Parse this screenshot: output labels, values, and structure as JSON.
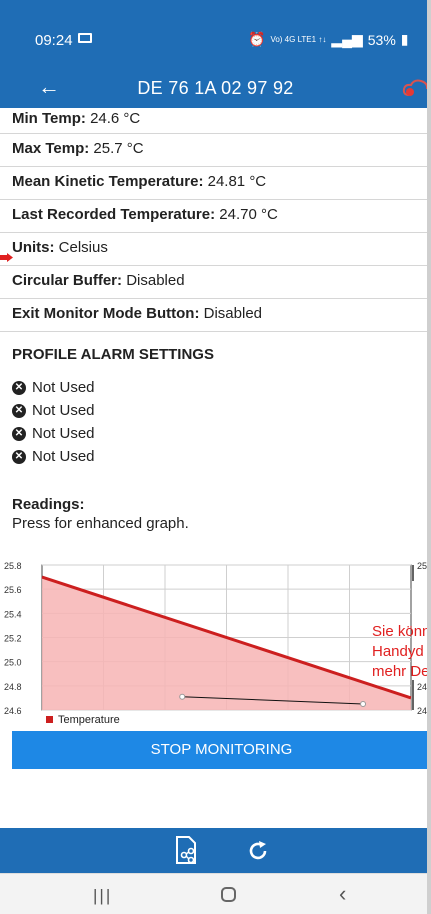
{
  "status_bar": {
    "time": "09:24",
    "network": "Vo) 4G LTE1 ↑↓",
    "battery": "53%"
  },
  "app_bar": {
    "title": "DE 76 1A 02 97 92"
  },
  "details": [
    {
      "label": "Min Temp:",
      "value": "24.6 °C"
    },
    {
      "label": "Max Temp:",
      "value": "25.7 °C"
    },
    {
      "label": "Mean Kinetic Temperature:",
      "value": "24.81 °C"
    },
    {
      "label": "Last Recorded Temperature:",
      "value": "24.70 °C"
    },
    {
      "label": "Units:",
      "value": "Celsius"
    },
    {
      "label": "Circular Buffer:",
      "value": "Disabled"
    },
    {
      "label": "Exit Monitor Mode Button:",
      "value": "Disabled"
    }
  ],
  "profile_alarm": {
    "heading": "PROFILE ALARM SETTINGS",
    "items": [
      "Not Used",
      "Not Used",
      "Not Used",
      "Not Used"
    ]
  },
  "readings": {
    "heading": "Readings:",
    "subtitle": "Press for enhanced graph."
  },
  "chart_data": {
    "type": "area",
    "ylim": [
      24.6,
      25.8
    ],
    "yticks": [
      "25.8",
      "25.6",
      "25.4",
      "25.2",
      "25.0",
      "24.8",
      "24.6"
    ],
    "right_tick_labels": [
      "25.",
      "24.",
      "24."
    ],
    "legend": [
      "Temperature"
    ],
    "series": [
      {
        "name": "Temperature",
        "color": "#cc1f1f",
        "x": [
          0,
          1
        ],
        "values": [
          25.7,
          24.7
        ]
      }
    ],
    "secondary_line": {
      "x": [
        0.38,
        0.87
      ],
      "values": [
        24.71,
        24.65
      ]
    },
    "grid": true
  },
  "stop_button": {
    "label": "STOP MONITORING"
  },
  "overlay_note": [
    "Sie könn",
    "Handyd",
    "mehr De"
  ],
  "bottom_icons": [
    "share-document-icon",
    "refresh-icon"
  ]
}
